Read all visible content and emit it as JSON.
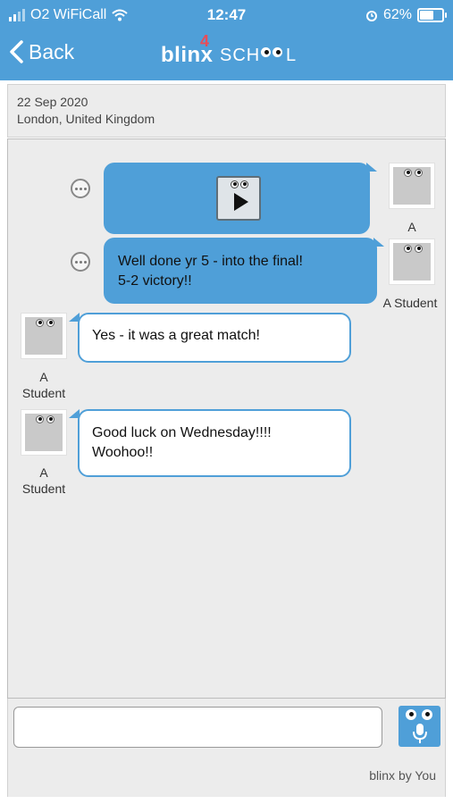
{
  "status_bar": {
    "carrier": "O2 WiFiCall",
    "time": "12:47",
    "battery": "62%",
    "icons": [
      "signal-icon",
      "wifi-icon",
      "alarm-icon",
      "battery-icon"
    ]
  },
  "header": {
    "back_label": "Back",
    "logo_brand": "blinx",
    "logo_four": "4",
    "logo_school": "SCH",
    "background_color": "#4f9fd8"
  },
  "info": {
    "date": "22 Sep 2020",
    "location": "London, United Kingdom"
  },
  "messages": [
    {
      "direction": "outgoing",
      "type": "video",
      "author": "A",
      "text": ""
    },
    {
      "direction": "outgoing",
      "type": "text",
      "author": "A Student",
      "line1": "Well done yr 5 - into the final!",
      "line2": "5-2 victory!!"
    },
    {
      "direction": "incoming",
      "type": "text",
      "author_line1": "A",
      "author_line2": "Student",
      "line1": "Yes - it was a great match!"
    },
    {
      "direction": "incoming",
      "type": "text",
      "author_line1": "A",
      "author_line2": "Student",
      "line1": "Good luck on Wednesday!!!!",
      "line2": "Woohoo!!"
    }
  ],
  "composer": {
    "input_value": "",
    "placeholder": "",
    "footer_brand": "blinx by You"
  }
}
